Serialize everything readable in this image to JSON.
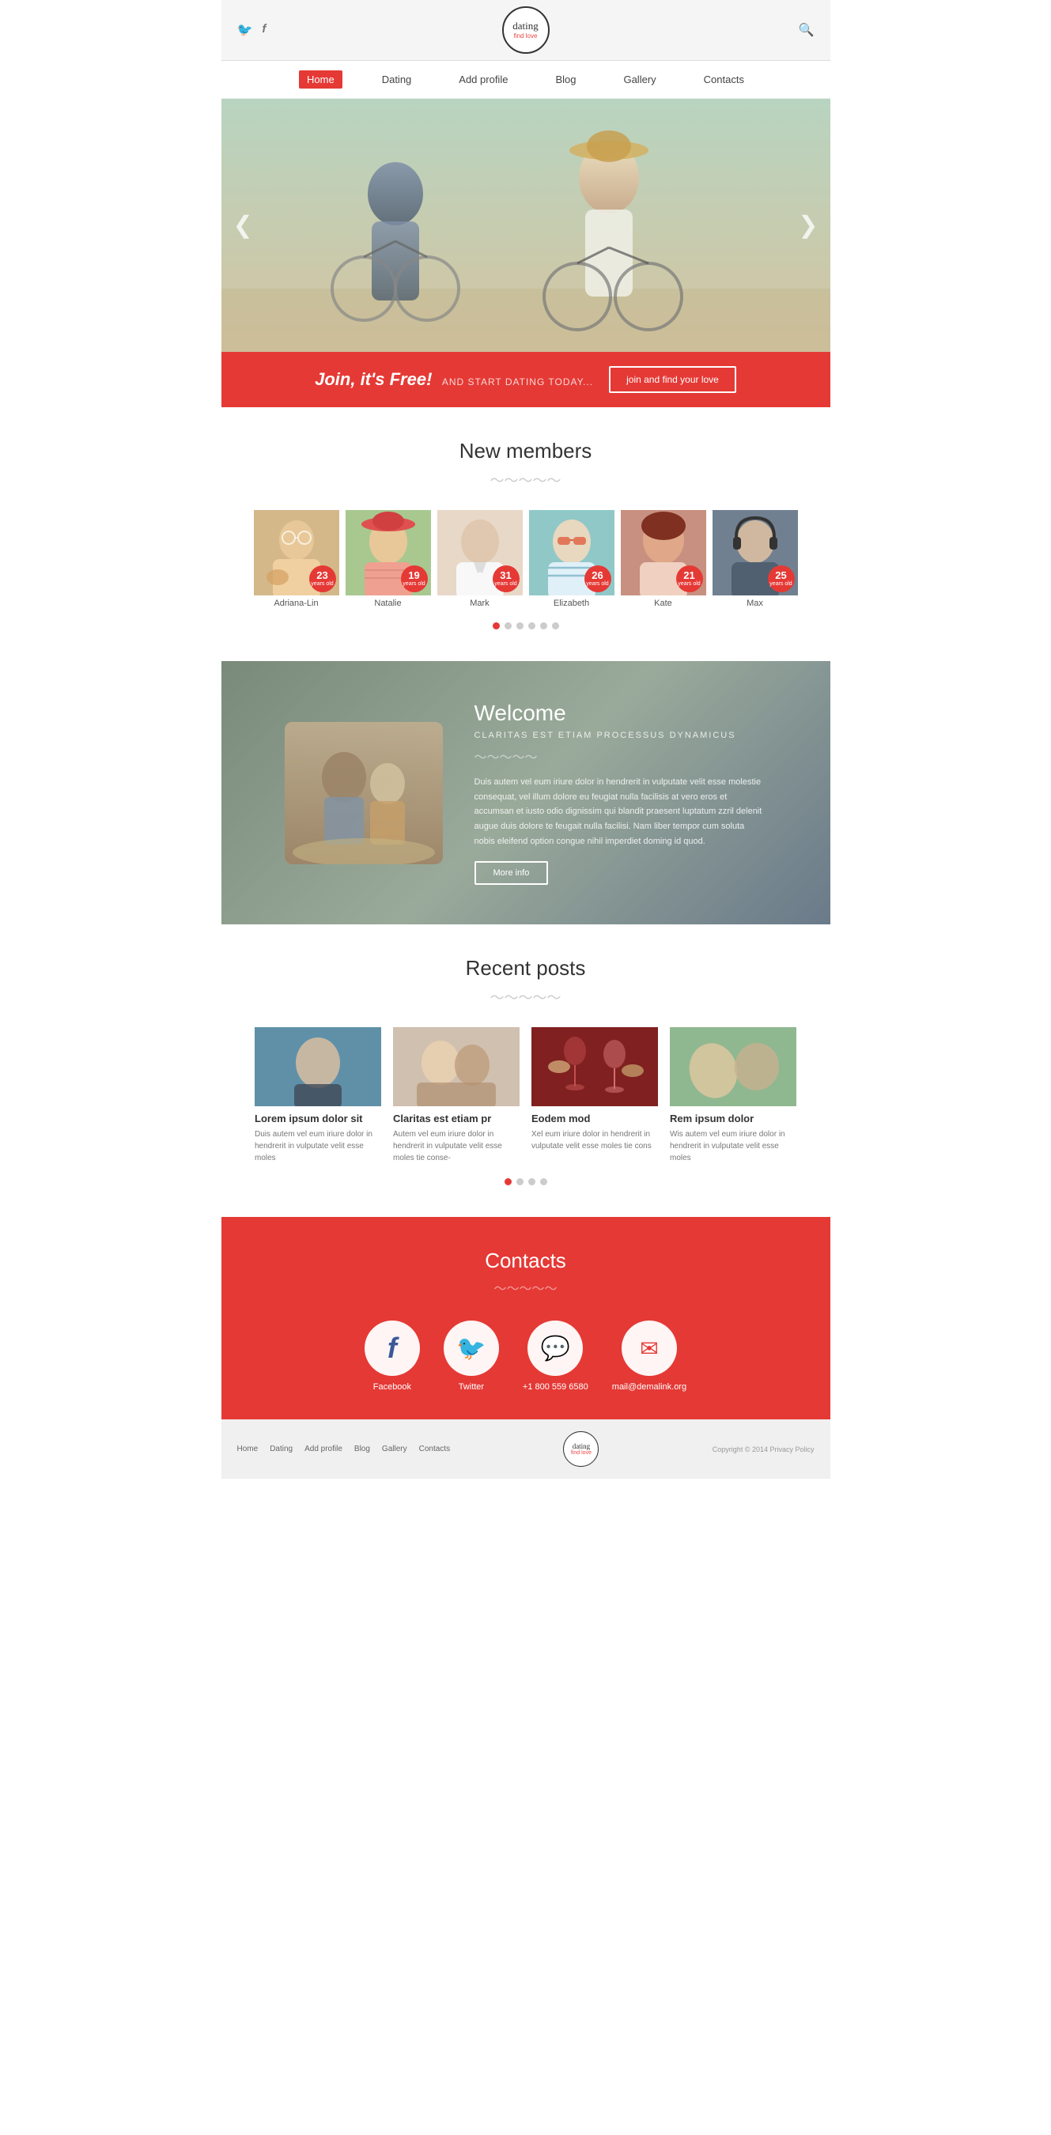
{
  "header": {
    "logo_text": "dating",
    "logo_sub": "find love",
    "twitter_icon": "🐦",
    "facebook_icon": "f",
    "search_icon": "🔍"
  },
  "nav": {
    "items": [
      {
        "label": "Home",
        "active": true
      },
      {
        "label": "Dating",
        "active": false
      },
      {
        "label": "Add profile",
        "active": false
      },
      {
        "label": "Blog",
        "active": false
      },
      {
        "label": "Gallery",
        "active": false
      },
      {
        "label": "Contacts",
        "active": false
      }
    ]
  },
  "hero": {
    "arrow_left": "❮",
    "arrow_right": "❯"
  },
  "cta": {
    "title": "Join, it's Free!",
    "subtitle": "AND START DATING TODAY...",
    "button_label": "join and find your love"
  },
  "new_members": {
    "section_title": "New members",
    "members": [
      {
        "name": "Adriana-Lin",
        "age": "23",
        "age_label": "years old"
      },
      {
        "name": "Natalie",
        "age": "19",
        "age_label": "years old"
      },
      {
        "name": "Mark",
        "age": "31",
        "age_label": "years old"
      },
      {
        "name": "Elizabeth",
        "age": "26",
        "age_label": "years old"
      },
      {
        "name": "Kate",
        "age": "21",
        "age_label": "years old"
      },
      {
        "name": "Max",
        "age": "25",
        "age_label": "years old"
      }
    ],
    "dots": [
      true,
      false,
      false,
      false,
      false,
      false
    ]
  },
  "welcome": {
    "title": "Welcome",
    "subtitle": "CLARITAS EST ETIAM PROCESSUS DYNAMICUS",
    "text": "Duis autem vel eum iriure dolor in hendrerit in vulputate velit esse molestie consequat, vel illum dolore eu feugiat nulla facilisis at vero eros et accumsan et iusto odio dignissim qui blandit praesent luptatum zzril delenit augue duis dolore te feugait nulla facilisi. Nam liber tempor cum soluta nobis eleifend option congue nihil imperdiet doming id quod.",
    "button_label": "More info"
  },
  "recent_posts": {
    "section_title": "Recent posts",
    "posts": [
      {
        "title": "Lorem ipsum dolor sit",
        "text": "Duis autem vel eum iriure dolor in hendrerit in vulputate velit esse moles"
      },
      {
        "title": "Claritas est etiam pr",
        "text": "Autem vel eum iriure dolor in hendrerit in vulputate velit esse moles tie conse-"
      },
      {
        "title": "Eodem mod",
        "text": "Xel eum iriure dolor in hendrerit in vulputate velit esse moles tie cons"
      },
      {
        "title": "Rem ipsum dolor",
        "text": "Wis autem vel eum iriure dolor in hendrerit in vulputate velit esse moles"
      }
    ],
    "dots": [
      true,
      false,
      false,
      false
    ]
  },
  "contacts": {
    "section_title": "Contacts",
    "items": [
      {
        "label": "Facebook",
        "icon": "f"
      },
      {
        "label": "Twitter",
        "icon": "🐦"
      },
      {
        "label": "+1 800 559 6580",
        "icon": "💬"
      },
      {
        "label": "mail@demalink.org",
        "icon": "✉"
      }
    ]
  },
  "footer": {
    "nav_items": [
      "Home",
      "Dating",
      "Add profile",
      "Blog",
      "Gallery",
      "Contacts"
    ],
    "logo_text": "dating",
    "logo_sub": "find love",
    "copyright": "Copyright © 2014 Privacy Policy"
  }
}
